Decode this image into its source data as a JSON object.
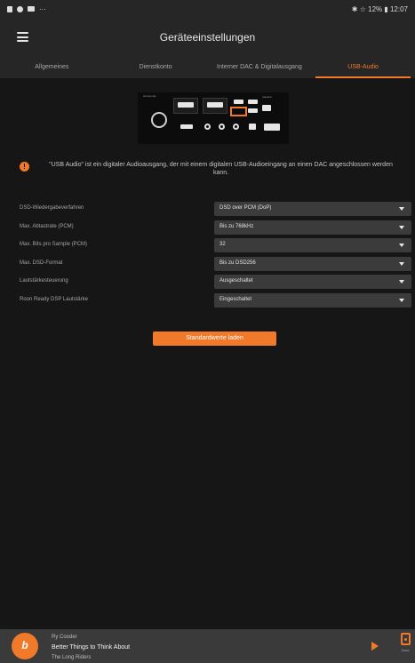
{
  "statusbar": {
    "left_icons": [
      "notification-icon",
      "settings-icon",
      "mail-icon"
    ],
    "dots": "···",
    "right_text": "✱ ☆ 12% ▮ 12:07"
  },
  "appbar": {
    "title": "Geräteeinstellungen"
  },
  "tabs": [
    {
      "label": "Allgemeines",
      "active": false
    },
    {
      "label": "Dienstkonto",
      "active": false
    },
    {
      "label": "Interner DAC & Digitalausgang",
      "active": false
    },
    {
      "label": "USB-Audio",
      "active": true
    }
  ],
  "device": {
    "brand": "NUCLEUS ONE",
    "port_label": "USB AUDIO"
  },
  "info": {
    "icon": "!",
    "text": "\"USB Audio\" ist ein digitaler Audioausgang, der mit einem digitalen USB-Audioeingang an einen DAC angeschlossen werden kann."
  },
  "settings": [
    {
      "label": "DSD-Wiedergabeverfahren",
      "value": "DSD over PCM (DoP)"
    },
    {
      "label": "Max. Abtastrate (PCM)",
      "value": "Bis zu 768kHz"
    },
    {
      "label": "Max. Bits pro Sample (PCM)",
      "value": "32"
    },
    {
      "label": "Max. DSD-Format",
      "value": "Bis zu DSD256"
    },
    {
      "label": "Lautstärkesteuerung",
      "value": "Ausgeschaltet"
    },
    {
      "label": "Roon Ready DSP Lautstärke",
      "value": "Eingeschaltet"
    }
  ],
  "reset_button": "Standardwerte laden",
  "player": {
    "logo_text": "b",
    "artist": "Ry Cooder",
    "title": "Better Things to Think About",
    "album": "The Long Riders",
    "zone_label": "Zone"
  },
  "colors": {
    "accent": "#f07a2a",
    "background": "#161616",
    "bar": "#262626",
    "select": "#3b3b3b"
  }
}
